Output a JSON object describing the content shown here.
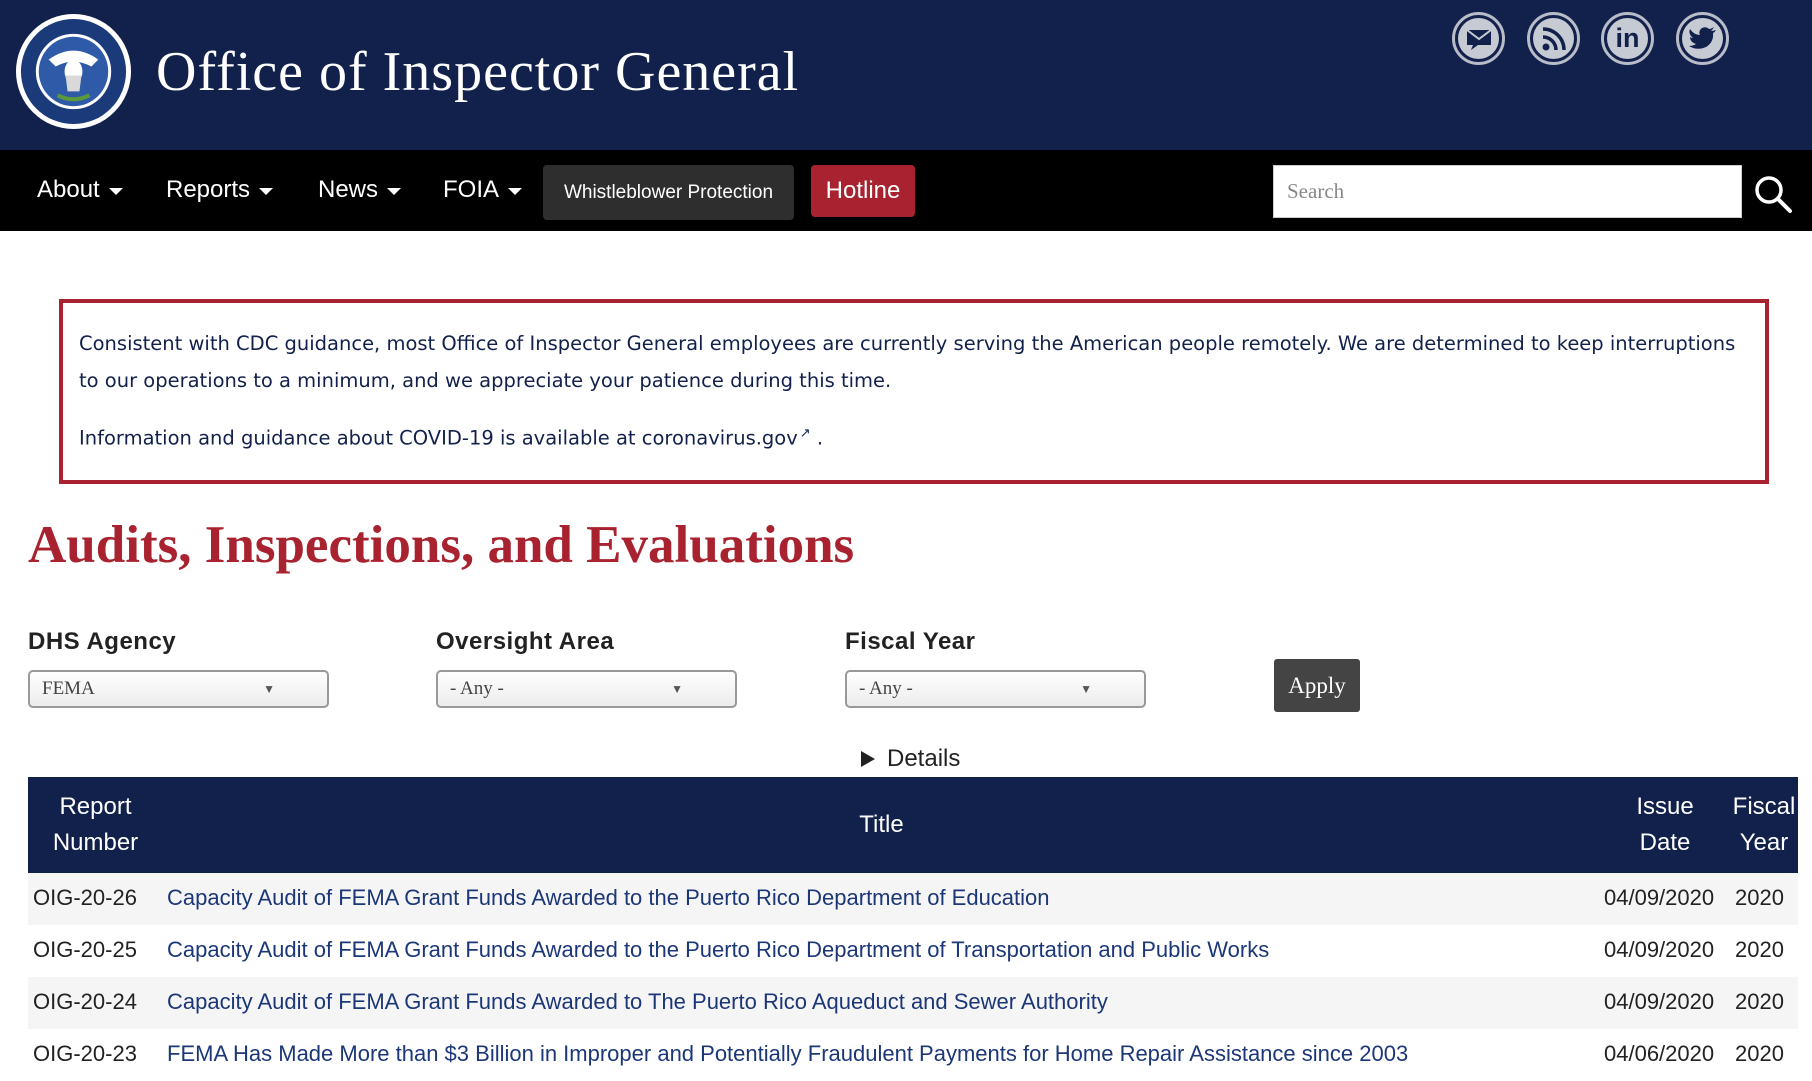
{
  "header": {
    "site_title": "Office of Inspector General",
    "seal_text_top": "U.S. DEPARTMENT OF",
    "seal_text_bottom": "HOMELAND SECURITY",
    "social_icons": [
      "email-icon",
      "rss-icon",
      "linkedin-icon",
      "twitter-icon"
    ]
  },
  "nav": {
    "items": [
      {
        "label": "About"
      },
      {
        "label": "Reports"
      },
      {
        "label": "News"
      },
      {
        "label": "FOIA"
      }
    ],
    "whistleblower_label": "Whistleblower Protection",
    "hotline_label": "Hotline",
    "search_placeholder": "Search"
  },
  "notice": {
    "paragraph1": "Consistent with CDC guidance, most Office of Inspector General employees are currently serving the American people remotely.  We are determined to keep interruptions to our operations to a minimum, and we appreciate your patience during this time.",
    "paragraph2_prefix": "Information and guidance about COVID-19 is available at ",
    "paragraph2_link": "coronavirus.gov",
    "paragraph2_suffix": " ."
  },
  "page_title": "Audits, Inspections, and Evaluations",
  "filters": {
    "agency_label": "DHS Agency",
    "agency_value": "FEMA",
    "oversight_label": "Oversight Area",
    "oversight_value": "- Any -",
    "year_label": "Fiscal Year",
    "year_value": "- Any -",
    "apply_label": "Apply",
    "details_label": "Details"
  },
  "table": {
    "headers": {
      "report_number_line1": "Report",
      "report_number_line2": "Number",
      "title": "Title",
      "issue_date_line1": "Issue",
      "issue_date_line2": "Date",
      "fiscal_year_line1": "Fiscal",
      "fiscal_year_line2": "Year"
    },
    "rows": [
      {
        "number": "OIG-20-26",
        "title": "Capacity Audit of FEMA Grant Funds Awarded to the Puerto Rico Department of Education",
        "date": "04/09/2020",
        "year": "2020"
      },
      {
        "number": "OIG-20-25",
        "title": "Capacity Audit of FEMA Grant Funds Awarded to the Puerto Rico Department of Transportation and Public Works",
        "date": "04/09/2020",
        "year": "2020"
      },
      {
        "number": "OIG-20-24",
        "title": "Capacity Audit of FEMA Grant Funds Awarded to The Puerto Rico Aqueduct and Sewer Authority",
        "date": "04/09/2020",
        "year": "2020"
      },
      {
        "number": "OIG-20-23",
        "title": "FEMA Has Made More than $3 Billion in Improper and Potentially Fraudulent Payments for Home Repair Assistance since 2003",
        "date": "04/06/2020",
        "year": "2020"
      }
    ]
  },
  "colors": {
    "navy": "#12214b",
    "crimson": "#a8232f",
    "link": "#1c3778"
  }
}
